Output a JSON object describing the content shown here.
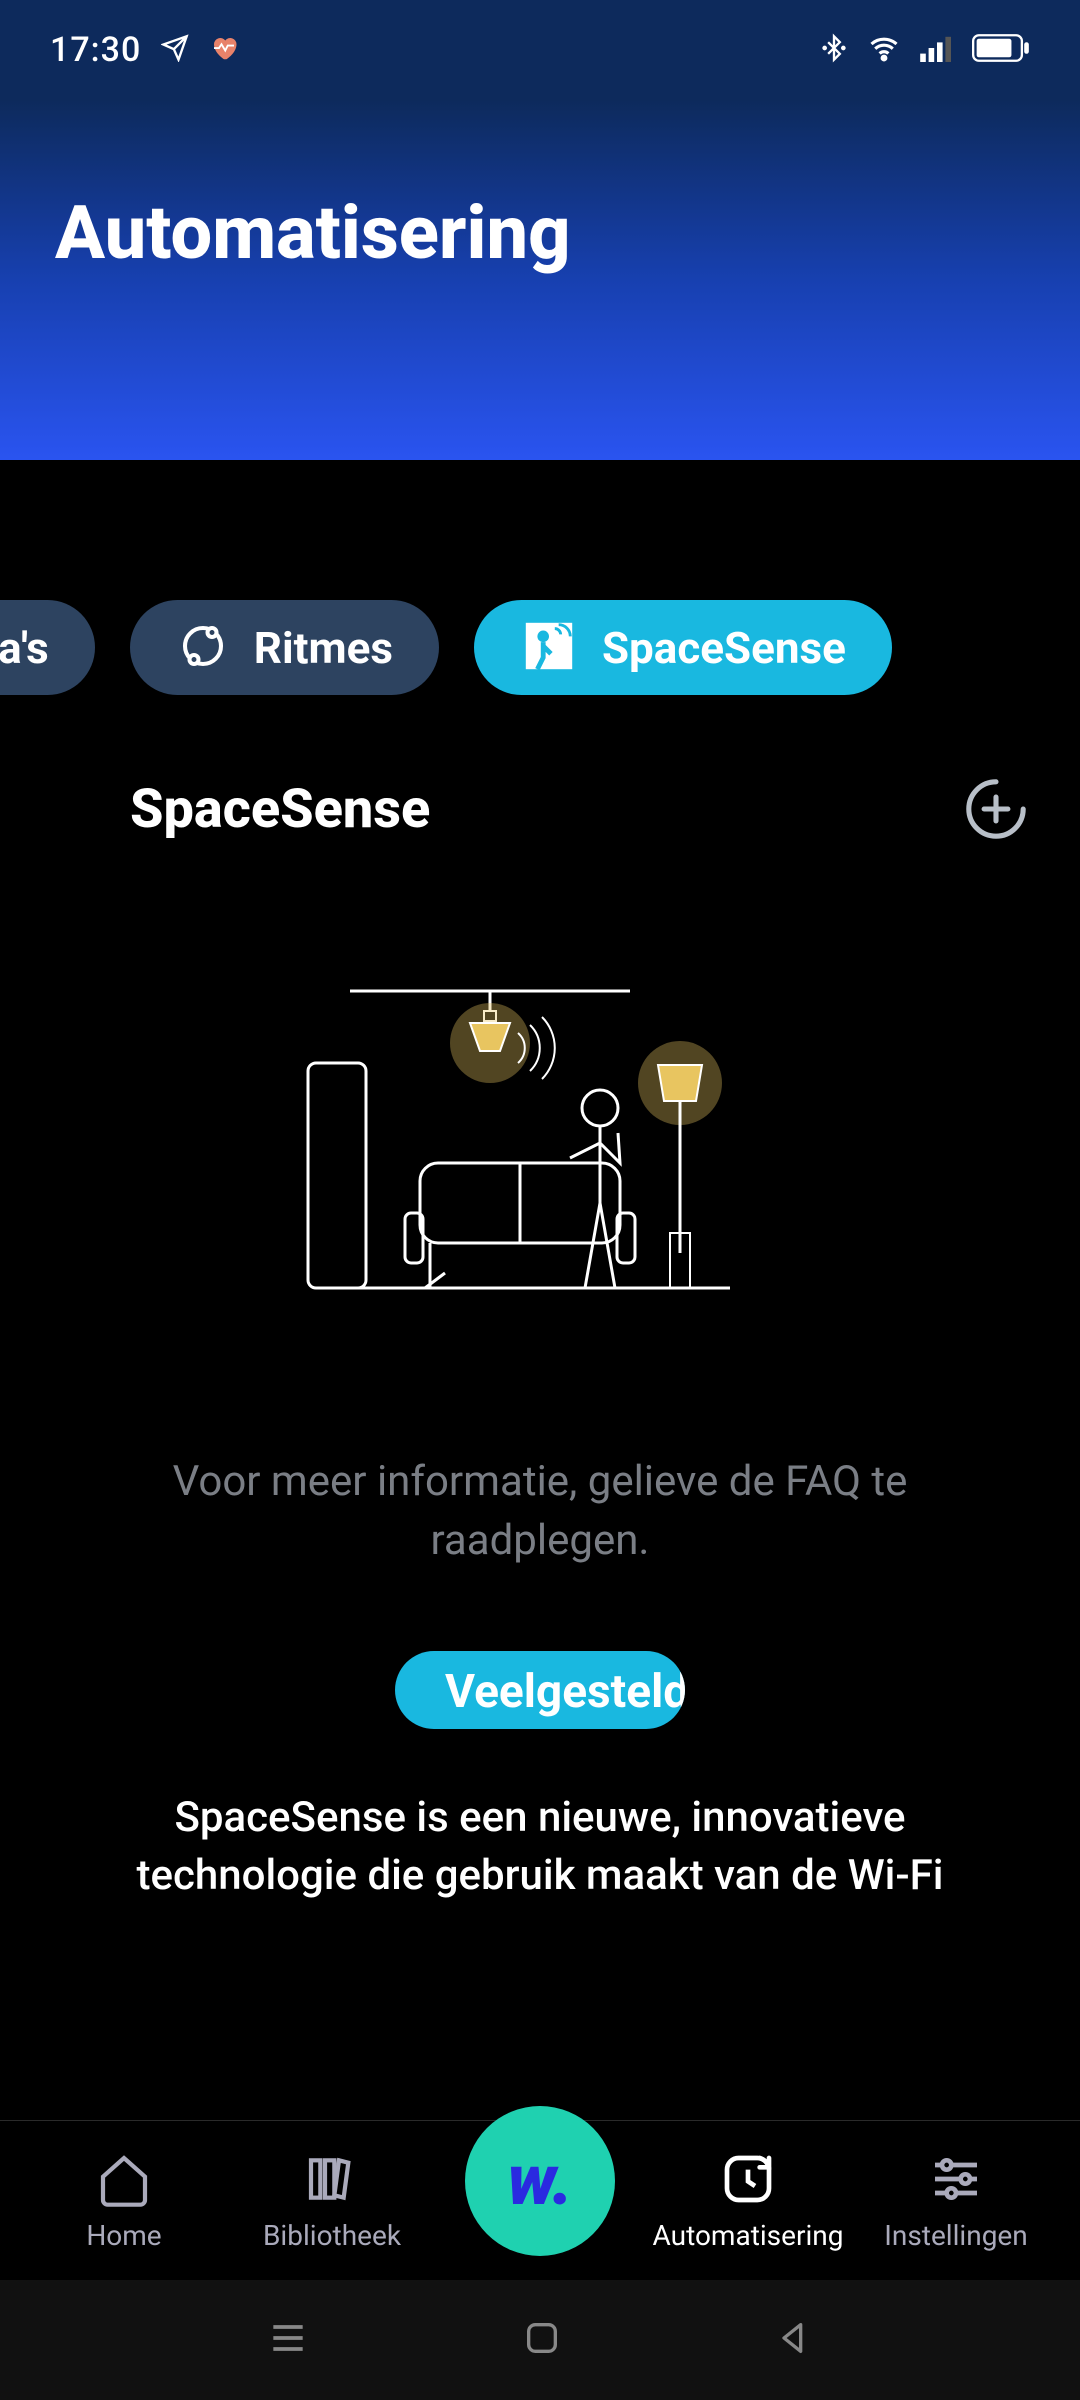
{
  "status": {
    "time": "17:30"
  },
  "header": {
    "title": "Automatisering"
  },
  "pills": {
    "partial": "ma's",
    "ritmes": "Ritmes",
    "spacesense": "SpaceSense"
  },
  "section": {
    "title": "SpaceSense"
  },
  "info": "Voor meer informatie, gelieve de FAQ te raadplegen.",
  "faq_button": "Veelgestelde vragen",
  "description": "SpaceSense is een nieuwe, innovatieve technologie die gebruik maakt van de Wi-Fi",
  "nav": {
    "home": "Home",
    "library": "Bibliotheek",
    "automation": "Automatisering",
    "settings": "Instellingen",
    "center": "w."
  }
}
